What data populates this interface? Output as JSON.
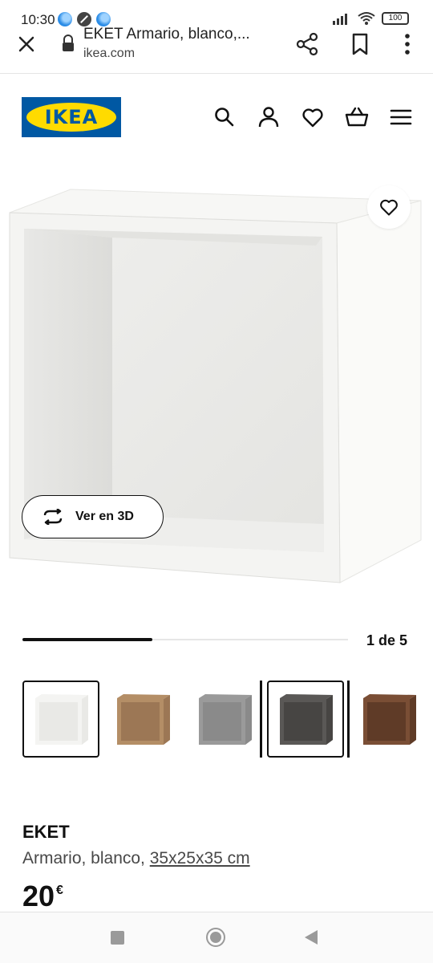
{
  "status_bar": {
    "time": "10:30",
    "battery": "100"
  },
  "browser": {
    "page_title": "EKET Armario, blanco,...",
    "domain": "ikea.com"
  },
  "header": {
    "logo_text": "IKEA",
    "icons": [
      "search-icon",
      "user-icon",
      "heart-icon",
      "basket-icon",
      "menu-icon"
    ]
  },
  "gallery": {
    "view_3d_label": "Ver en 3D",
    "progress_text": "1 de 5",
    "progress_fraction": 0.2,
    "variants": [
      {
        "name": "blanco",
        "color": "#f4f4f2",
        "inner": "#e9e9e6"
      },
      {
        "name": "roble",
        "color": "#b48e66",
        "inner": "#9c7755"
      },
      {
        "name": "gris claro",
        "color": "#9a9a9a",
        "inner": "#8a8a8a"
      },
      {
        "name": "gris oscuro",
        "color": "#5a5856",
        "inner": "#474543"
      },
      {
        "name": "nogal",
        "color": "#7a4e35",
        "inner": "#5f3b27"
      }
    ]
  },
  "product": {
    "name": "EKET",
    "description_prefix": "Armario, blanco, ",
    "dimensions": "35x25x35 cm",
    "price": "20",
    "currency": "€"
  },
  "colors": {
    "brand_blue": "#0058a3",
    "brand_yellow": "#ffdb00"
  }
}
